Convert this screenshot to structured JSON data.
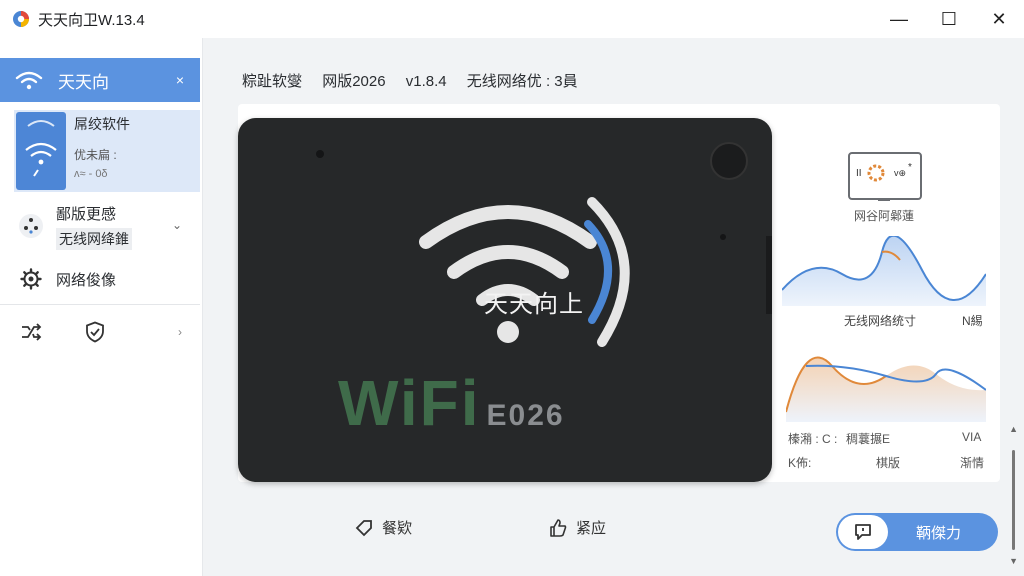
{
  "window": {
    "title": "天天向卫W.13.4",
    "controls": {
      "minimize": "—",
      "maximize": "☐",
      "close": "✕"
    }
  },
  "sidebar": {
    "active_item": {
      "label": "天天向",
      "close": "×"
    },
    "card": {
      "title": "屌绞软件",
      "line1": "优未扁 :",
      "line2": "ʌ≈ - 0δ"
    },
    "update_item": {
      "line1": "鄙版更感",
      "line2": "无线网绛錐"
    },
    "settings_item": {
      "label": "网络俊像"
    },
    "tools_item": {}
  },
  "header": {
    "parts": [
      "粽趾软燮",
      "网版2026",
      "v1.8.4",
      "无线网络优 : 3員"
    ]
  },
  "hero": {
    "title": "天天向上",
    "brand": "WiFi",
    "brand_suffix": "E026"
  },
  "right_panel": {
    "monitor_label": "网谷阿鄵蓮",
    "chart1_caption": "无线网络统寸",
    "chart1_caption_right": "N緆",
    "stats": [
      {
        "a": "榛潲 : C :",
        "b": "稠蘘搌Ε",
        "c": "VIA"
      },
      {
        "a": "K佈:",
        "b": "棋版",
        "c": "渐情"
      }
    ]
  },
  "actions": {
    "feedback_label": "餐欵",
    "like_label": "紧应",
    "primary_label": "鞆傑力"
  },
  "colors": {
    "accent": "#5b93e0",
    "orange": "#e0893a",
    "chart_blue": "#4a86d4"
  }
}
